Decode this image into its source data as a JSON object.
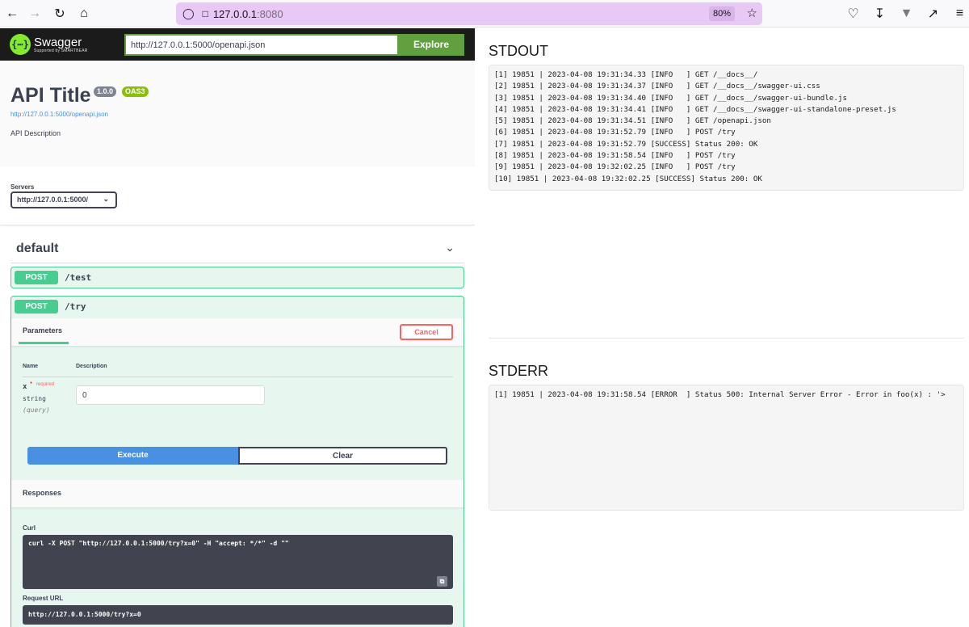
{
  "browser": {
    "url_host": "127.0.0.1",
    "url_port": ":8080",
    "zoom": "80%"
  },
  "swagger": {
    "brand_name": "Swagger",
    "brand_sub": "Supported by SMARTBEAR",
    "spec_url": "http://127.0.0.1:5000/openapi.json",
    "explore_label": "Explore",
    "api_title": "API Title",
    "version_badge": "1.0.0",
    "oas_badge": "OAS3",
    "info_link": "http://127.0.0.1:5000/openapi.json",
    "description": "API Description",
    "servers_label": "Servers",
    "server_selected": "http://127.0.0.1:5000/",
    "tag_title": "default",
    "operations": [
      {
        "method": "POST",
        "path": "/test"
      },
      {
        "method": "POST",
        "path": "/try"
      }
    ],
    "parameters_tab": "Parameters",
    "cancel_label": "Cancel",
    "col_name": "Name",
    "col_description": "Description",
    "param": {
      "name": "x",
      "required_star": "*",
      "required_label": "required",
      "type": "string",
      "in": "(query)",
      "value": "0"
    },
    "execute_label": "Execute",
    "clear_label": "Clear",
    "responses_title": "Responses",
    "curl_label": "Curl",
    "curl_command": "curl -X POST \"http://127.0.0.1:5000/try?x=0\" -H \"accept: */*\" -d \"\"",
    "request_url_label": "Request URL",
    "request_url": "http://127.0.0.1:5000/try?x=0"
  },
  "stdout": {
    "title": "STDOUT",
    "lines": [
      "[1] 19851 | 2023-04-08 19:31:34.33 [INFO   ] GET /__docs__/",
      "[2] 19851 | 2023-04-08 19:31:34.37 [INFO   ] GET /__docs__/swagger-ui.css",
      "[3] 19851 | 2023-04-08 19:31:34.40 [INFO   ] GET /__docs__/swagger-ui-bundle.js",
      "[4] 19851 | 2023-04-08 19:31:34.41 [INFO   ] GET /__docs__/swagger-ui-standalone-preset.js",
      "[5] 19851 | 2023-04-08 19:31:34.51 [INFO   ] GET /openapi.json",
      "[6] 19851 | 2023-04-08 19:31:52.79 [INFO   ] POST /try",
      "[7] 19851 | 2023-04-08 19:31:52.79 [SUCCESS] Status 200: OK",
      "[8] 19851 | 2023-04-08 19:31:58.54 [INFO   ] POST /try",
      "[9] 19851 | 2023-04-08 19:32:02.25 [INFO   ] POST /try",
      "[10] 19851 | 2023-04-08 19:32:02.25 [SUCCESS] Status 200: OK"
    ]
  },
  "stderr": {
    "title": "STDERR",
    "lines": [
      "[1] 19851 | 2023-04-08 19:31:58.54 [ERROR  ] Status 500: Internal Server Error - Error in foo(x) : '>"
    ]
  }
}
